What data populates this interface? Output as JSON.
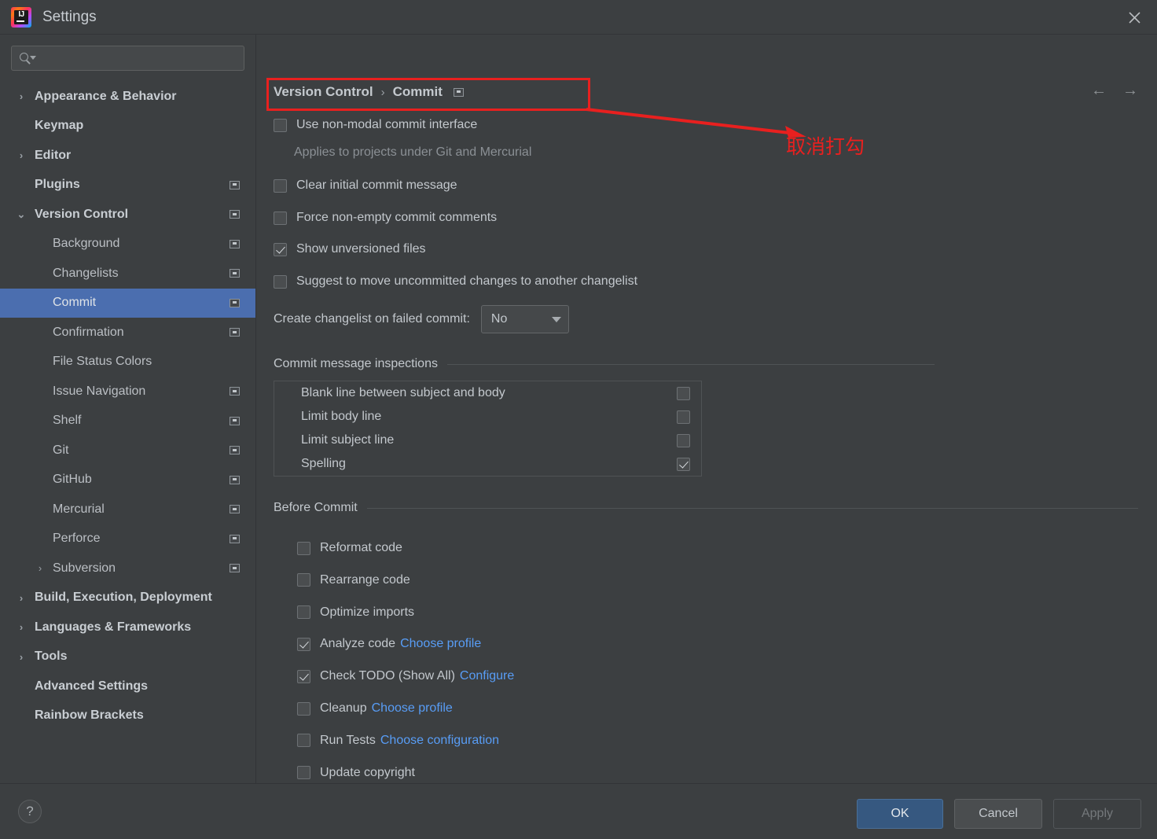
{
  "window": {
    "title": "Settings",
    "logo_text": "IJ",
    "close_icon": "close-icon"
  },
  "search": {
    "value": "",
    "placeholder": "",
    "icon": "search-icon"
  },
  "sidebar": {
    "items": [
      {
        "label": "Appearance & Behavior",
        "level": 0,
        "chevron": "›",
        "bold": true,
        "scope": false,
        "selected": false
      },
      {
        "label": "Keymap",
        "level": 0,
        "chevron": "",
        "bold": true,
        "scope": false,
        "selected": false
      },
      {
        "label": "Editor",
        "level": 0,
        "chevron": "›",
        "bold": true,
        "scope": false,
        "selected": false
      },
      {
        "label": "Plugins",
        "level": 0,
        "chevron": "",
        "bold": true,
        "scope": true,
        "selected": false
      },
      {
        "label": "Version Control",
        "level": 0,
        "chevron": "⌄",
        "bold": true,
        "scope": true,
        "selected": false
      },
      {
        "label": "Background",
        "level": 1,
        "chevron": "",
        "bold": false,
        "scope": true,
        "selected": false
      },
      {
        "label": "Changelists",
        "level": 1,
        "chevron": "",
        "bold": false,
        "scope": true,
        "selected": false
      },
      {
        "label": "Commit",
        "level": 1,
        "chevron": "",
        "bold": false,
        "scope": true,
        "selected": true
      },
      {
        "label": "Confirmation",
        "level": 1,
        "chevron": "",
        "bold": false,
        "scope": true,
        "selected": false
      },
      {
        "label": "File Status Colors",
        "level": 1,
        "chevron": "",
        "bold": false,
        "scope": false,
        "selected": false
      },
      {
        "label": "Issue Navigation",
        "level": 1,
        "chevron": "",
        "bold": false,
        "scope": true,
        "selected": false
      },
      {
        "label": "Shelf",
        "level": 1,
        "chevron": "",
        "bold": false,
        "scope": true,
        "selected": false
      },
      {
        "label": "Git",
        "level": 1,
        "chevron": "",
        "bold": false,
        "scope": true,
        "selected": false
      },
      {
        "label": "GitHub",
        "level": 1,
        "chevron": "",
        "bold": false,
        "scope": true,
        "selected": false
      },
      {
        "label": "Mercurial",
        "level": 1,
        "chevron": "",
        "bold": false,
        "scope": true,
        "selected": false
      },
      {
        "label": "Perforce",
        "level": 1,
        "chevron": "",
        "bold": false,
        "scope": true,
        "selected": false
      },
      {
        "label": "Subversion",
        "level": 1,
        "chevron": "›",
        "bold": false,
        "scope": true,
        "selected": false
      },
      {
        "label": "Build, Execution, Deployment",
        "level": 0,
        "chevron": "›",
        "bold": true,
        "scope": false,
        "selected": false
      },
      {
        "label": "Languages & Frameworks",
        "level": 0,
        "chevron": "›",
        "bold": true,
        "scope": false,
        "selected": false
      },
      {
        "label": "Tools",
        "level": 0,
        "chevron": "›",
        "bold": true,
        "scope": false,
        "selected": false
      },
      {
        "label": "Advanced Settings",
        "level": 0,
        "chevron": "",
        "bold": true,
        "scope": false,
        "selected": false
      },
      {
        "label": "Rainbow Brackets",
        "level": 0,
        "chevron": "",
        "bold": true,
        "scope": false,
        "selected": false
      }
    ]
  },
  "breadcrumb": {
    "parent": "Version Control",
    "separator": "›",
    "current": "Commit"
  },
  "nav": {
    "back": "←",
    "forward": "→"
  },
  "main": {
    "options": [
      {
        "label": "Use non-modal commit interface",
        "checked": false
      },
      {
        "label": "Clear initial commit message",
        "checked": false
      },
      {
        "label": "Force non-empty commit comments",
        "checked": false
      },
      {
        "label": "Show unversioned files",
        "checked": true
      },
      {
        "label": "Suggest to move uncommitted changes to another changelist",
        "checked": false
      }
    ],
    "hint": "Applies to projects under Git and Mercurial",
    "changelist": {
      "label": "Create changelist on failed commit:",
      "value": "No"
    },
    "inspections": {
      "title": "Commit message inspections",
      "rows": [
        {
          "label": "Blank line between subject and body",
          "checked": false
        },
        {
          "label": "Limit body line",
          "checked": false
        },
        {
          "label": "Limit subject line",
          "checked": false
        },
        {
          "label": "Spelling",
          "checked": true
        }
      ]
    },
    "before_commit": {
      "title": "Before Commit",
      "rows": [
        {
          "label": "Reformat code",
          "checked": false,
          "link": ""
        },
        {
          "label": "Rearrange code",
          "checked": false,
          "link": ""
        },
        {
          "label": "Optimize imports",
          "checked": false,
          "link": ""
        },
        {
          "label": "Analyze code",
          "checked": true,
          "link": "Choose profile"
        },
        {
          "label": "Check TODO (Show All)",
          "checked": true,
          "link": "Configure"
        },
        {
          "label": "Cleanup",
          "checked": false,
          "link": "Choose profile"
        },
        {
          "label": "Run Tests",
          "checked": false,
          "link": "Choose configuration"
        },
        {
          "label": "Update copyright",
          "checked": false,
          "link": ""
        }
      ]
    }
  },
  "annotation": {
    "text": "取消打勾",
    "color": "#e8201f"
  },
  "footer": {
    "help": "?",
    "ok": "OK",
    "cancel": "Cancel",
    "apply": "Apply"
  }
}
